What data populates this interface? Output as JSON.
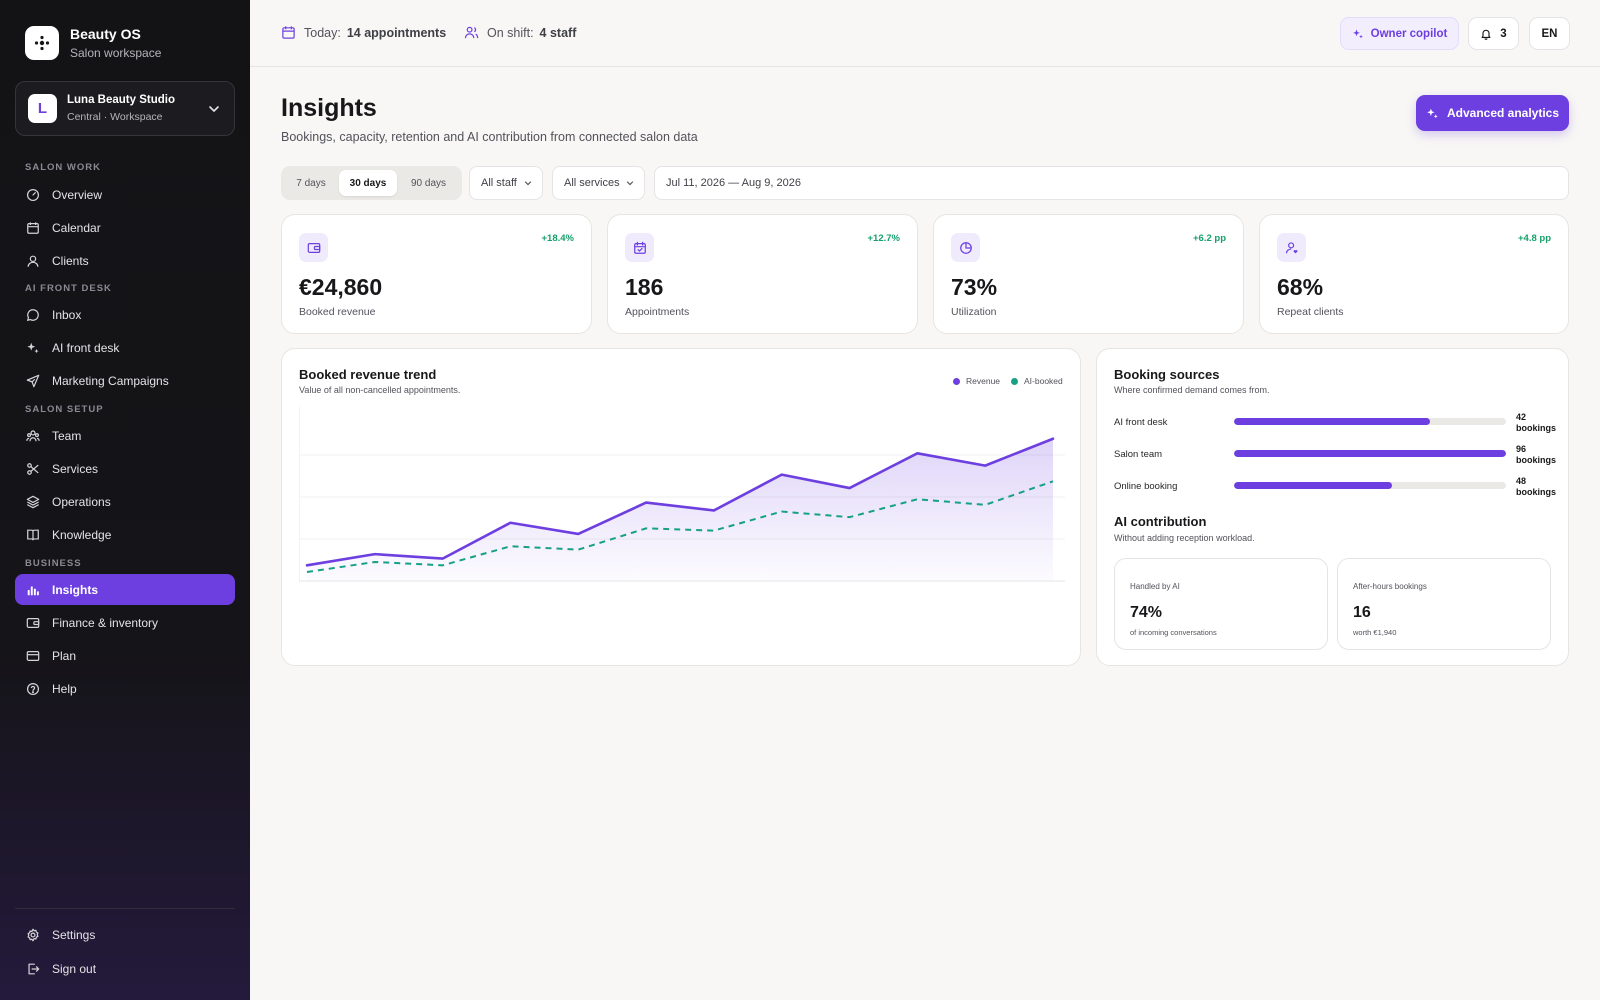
{
  "brand": {
    "name": "Beauty OS",
    "subtitle": "Salon workspace"
  },
  "workspace": {
    "initial": "L",
    "name": "Luna Beauty Studio",
    "subtitle": "Central · Workspace"
  },
  "sidebar": {
    "sections": [
      {
        "label": "SALON WORK"
      },
      {
        "label": "AI FRONT DESK"
      },
      {
        "label": "SALON SETUP"
      },
      {
        "label": "BUSINESS"
      }
    ],
    "items": [
      {
        "label": "Overview",
        "icon": "gauge-icon"
      },
      {
        "label": "Calendar",
        "icon": "calendar-icon"
      },
      {
        "label": "Clients",
        "icon": "user-icon"
      },
      {
        "label": "Inbox",
        "icon": "chat-icon"
      },
      {
        "label": "AI front desk",
        "icon": "sparkles-icon"
      },
      {
        "label": "Marketing Campaigns",
        "icon": "send-icon"
      },
      {
        "label": "Team",
        "icon": "team-icon"
      },
      {
        "label": "Services",
        "icon": "scissors-icon"
      },
      {
        "label": "Operations",
        "icon": "layers-icon"
      },
      {
        "label": "Knowledge",
        "icon": "book-icon"
      },
      {
        "label": "Insights",
        "icon": "bar-chart-icon",
        "active": true
      },
      {
        "label": "Finance & inventory",
        "icon": "wallet-icon"
      },
      {
        "label": "Plan",
        "icon": "card-icon"
      },
      {
        "label": "Help",
        "icon": "help-icon"
      }
    ],
    "footer": [
      {
        "label": "Settings",
        "icon": "gear-icon"
      },
      {
        "label": "Sign out",
        "icon": "sign-out-icon"
      }
    ]
  },
  "topbar": {
    "today_label": "Today:",
    "today_value": "14 appointments",
    "shift_label": "On shift:",
    "shift_value": "4 staff",
    "copilot_label": "Owner copilot",
    "notifications_count": "3",
    "language": "EN"
  },
  "header": {
    "title": "Insights",
    "subtitle": "Bookings, capacity, retention and AI contribution from connected salon data",
    "action_label": "Advanced analytics"
  },
  "filters": {
    "ranges": [
      "7 days",
      "30 days",
      "90 days"
    ],
    "selected_range": "30 days",
    "staff": "All staff",
    "services": "All services",
    "date_range": "Jul 11, 2026 — Aug 9, 2026"
  },
  "kpis": [
    {
      "value": "€24,860",
      "label": "Booked revenue",
      "delta": "+18.4%",
      "icon": "wallet-icon"
    },
    {
      "value": "186",
      "label": "Appointments",
      "delta": "+12.7%",
      "icon": "calendar-check-icon"
    },
    {
      "value": "73%",
      "label": "Utilization",
      "delta": "+6.2 pp",
      "icon": "pie-icon"
    },
    {
      "value": "68%",
      "label": "Repeat clients",
      "delta": "+4.8 pp",
      "icon": "user-heart-icon"
    }
  ],
  "revenue_chart": {
    "title": "Booked revenue trend",
    "subtitle": "Value of all non-cancelled appointments.",
    "legend": [
      "Revenue",
      "AI-booked"
    ]
  },
  "chart_data": {
    "type": "line",
    "series": [
      {
        "name": "Revenue",
        "values": [
          14,
          24,
          20,
          52,
          42,
          70,
          63,
          95,
          83,
          114,
          103,
          127
        ],
        "color": "#6d3fe0"
      },
      {
        "name": "AI-booked",
        "values": [
          8,
          17,
          14,
          31,
          28,
          47,
          45,
          62,
          57,
          73,
          68,
          89
        ],
        "color": "#16a085"
      }
    ],
    "ylim": [
      0,
      150
    ],
    "grid": true,
    "legend_position": "top-right"
  },
  "booking_sources": {
    "title": "Booking sources",
    "subtitle": "Where confirmed demand comes from.",
    "rows": [
      {
        "label": "AI front desk",
        "count": "42",
        "unit": "bookings",
        "share": 0.72
      },
      {
        "label": "Salon team",
        "count": "96",
        "unit": "bookings",
        "share": 1.0
      },
      {
        "label": "Online booking",
        "count": "48",
        "unit": "bookings",
        "share": 0.58
      }
    ]
  },
  "ai_contribution": {
    "title": "AI contribution",
    "subtitle": "Without adding reception workload.",
    "cards": [
      {
        "label": "Handled by AI",
        "value": "74%",
        "sub": "of incoming conversations"
      },
      {
        "label": "After-hours bookings",
        "value": "16",
        "sub": "worth €1,940"
      }
    ]
  },
  "colors": {
    "accent": "#6d3fe0",
    "positive": "#16a06b",
    "ai_series": "#16a085"
  }
}
